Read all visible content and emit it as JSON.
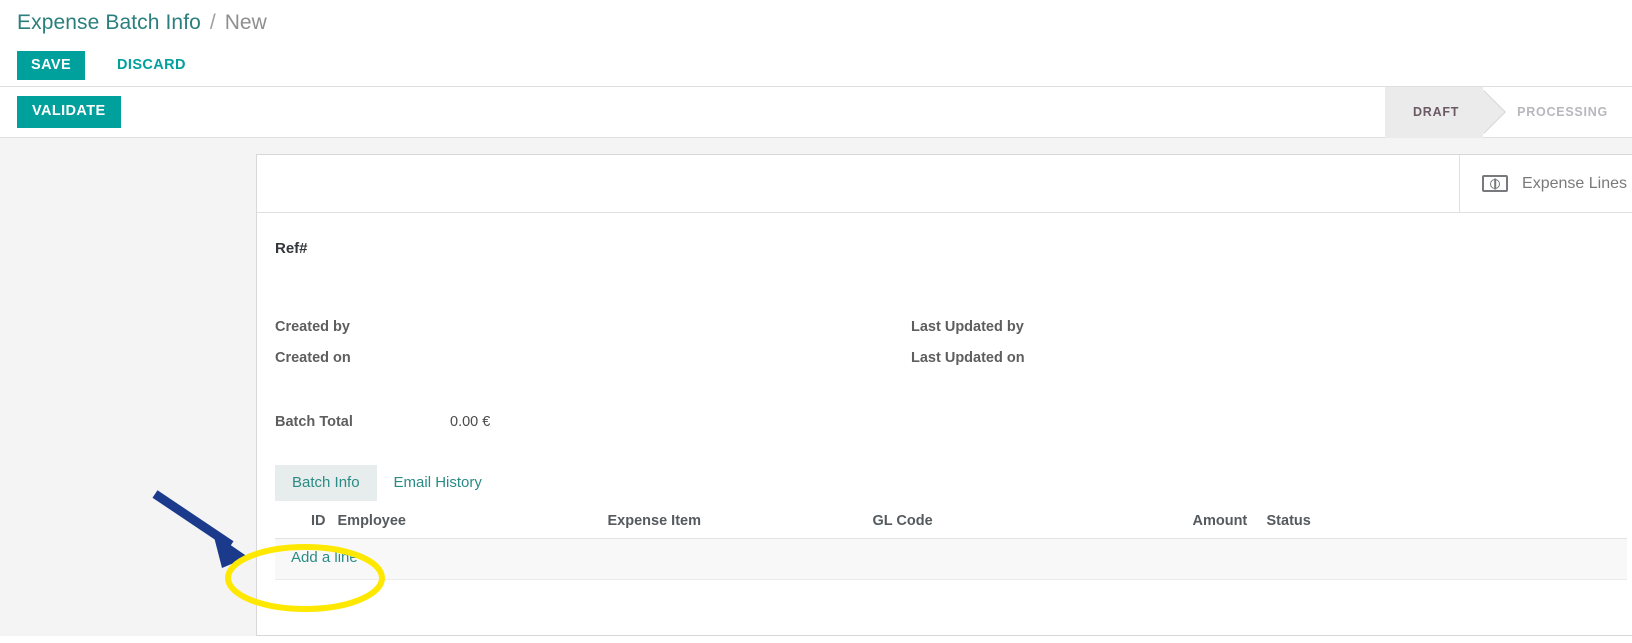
{
  "breadcrumb": {
    "root": "Expense Batch Info",
    "separator": "/",
    "current": "New"
  },
  "toolbar": {
    "save_label": "SAVE",
    "discard_label": "DISCARD"
  },
  "control_panel": {
    "validate_label": "VALIDATE",
    "statusbar": [
      {
        "label": "DRAFT",
        "active": true
      },
      {
        "label": "PROCESSING",
        "active": false
      }
    ]
  },
  "stat_buttons": [
    {
      "label": "Expense Lines",
      "icon": "money-bill-icon"
    }
  ],
  "form": {
    "ref": {
      "label": "Ref#",
      "value": ""
    },
    "fields": [
      {
        "label": "Created by",
        "value": ""
      },
      {
        "label": "Last Updated by",
        "value": ""
      },
      {
        "label": "Created on",
        "value": ""
      },
      {
        "label": "Last Updated on",
        "value": ""
      }
    ],
    "batch_total": {
      "label": "Batch Total",
      "value": "0.00 €"
    }
  },
  "notebook": {
    "tabs": [
      {
        "label": "Batch Info",
        "active": true
      },
      {
        "label": "Email History",
        "active": false
      }
    ],
    "columns": [
      "ID",
      "Employee",
      "Expense Item",
      "GL Code",
      "Amount",
      "Status"
    ],
    "rows": [],
    "add_line_label": "Add a line"
  },
  "annotations": {
    "arrow_color": "#1b3a8c",
    "ellipse_color": "#ffe800"
  },
  "colors": {
    "accent": "#00a09d",
    "link": "#2a8b86",
    "background": "#f4f4f4"
  }
}
